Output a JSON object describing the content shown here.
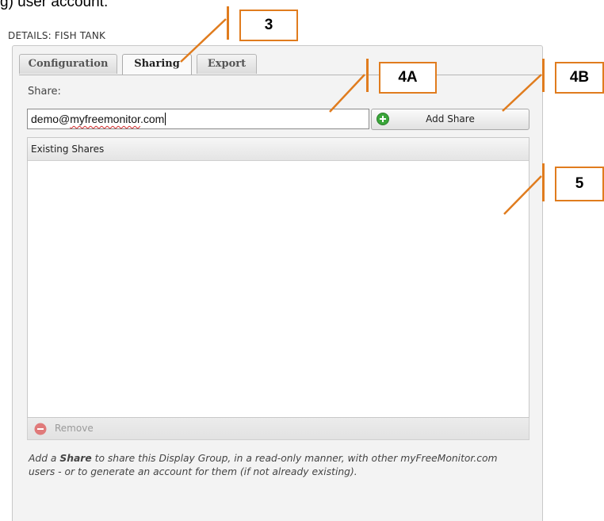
{
  "intro_text": "g) user account.",
  "details_title": "DETAILS: FISH TANK",
  "tabs": [
    {
      "label": "Configuration",
      "active": false
    },
    {
      "label": "Sharing",
      "active": true
    },
    {
      "label": "Export",
      "active": false
    }
  ],
  "share": {
    "label": "Share:",
    "value_prefix": "demo@",
    "value_misspelled": "myfreemonitor",
    "value_suffix": ".com"
  },
  "add_share_button": {
    "label": "Add Share",
    "icon": "plus-circle-icon"
  },
  "existing_shares": {
    "header": "Existing Shares",
    "rows": []
  },
  "remove_button": {
    "label": "Remove",
    "icon": "minus-circle-icon",
    "enabled": false
  },
  "help": {
    "before": "Add a ",
    "bold": "Share",
    "after": " to share this Display Group, in a read-only manner, with other myFreeMonitor.com users - or to generate an account for them (if not already existing)."
  },
  "callouts": [
    {
      "id": "3",
      "label": "3"
    },
    {
      "id": "4A",
      "label": "4A"
    },
    {
      "id": "4B",
      "label": "4B"
    },
    {
      "id": "5",
      "label": "5"
    }
  ],
  "colors": {
    "callout_orange": "#e07c1e",
    "add_icon_green": "#3aa63a",
    "remove_icon_red": "#e07a7a"
  }
}
